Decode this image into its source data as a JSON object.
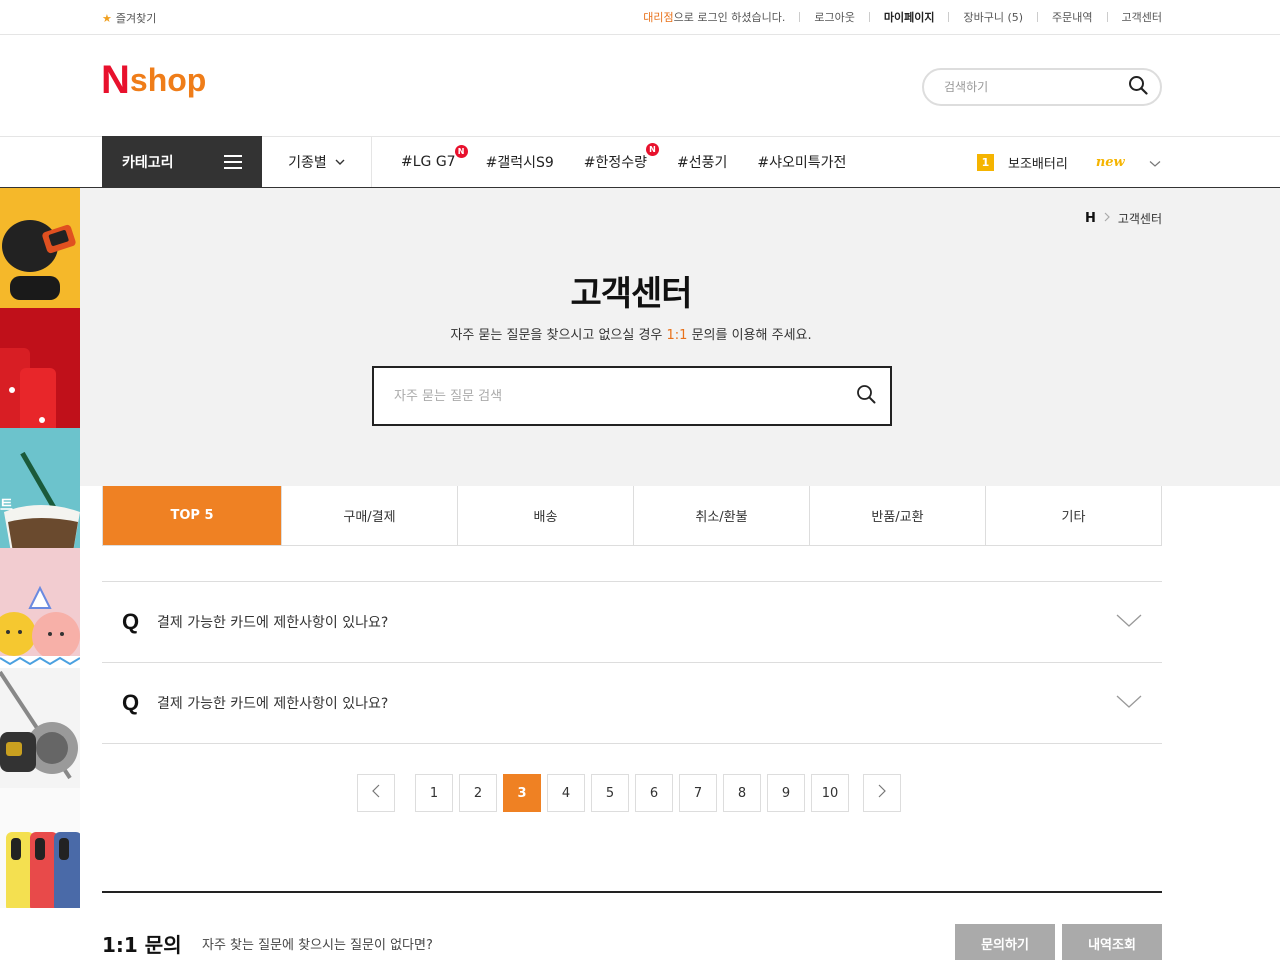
{
  "topbar": {
    "favorites": "즐겨찾기",
    "login_highlight": "대리점",
    "login_rest": "으로 로그인 하셨습니다.",
    "logout": "로그아웃",
    "mypage": "마이페이지",
    "cart": "장바구니 (5)",
    "orders": "주문내역",
    "support": "고객센터"
  },
  "header": {
    "logo_n": "N",
    "logo_shop": "shop",
    "search_placeholder": "검색하기"
  },
  "nav": {
    "category": "카테고리",
    "by_model": "기종별",
    "tags": [
      {
        "label": "#LG G7",
        "badge": "N"
      },
      {
        "label": "#갤럭시S9",
        "badge": ""
      },
      {
        "label": "#한정수량",
        "badge": "N"
      },
      {
        "label": "#선풍기",
        "badge": ""
      },
      {
        "label": "#샤오미특가전",
        "badge": ""
      }
    ],
    "rank_number": "1",
    "rank_label": "보조배터리",
    "rank_new": "new"
  },
  "breadcrumb": {
    "home": "H",
    "current": "고객센터"
  },
  "hero": {
    "title": "고객센터",
    "sub_before": "자주 묻는 질문을 찾으시고 없으실 경우 ",
    "sub_accent": "1:1",
    "sub_after": " 문의를 이용해 주세요.",
    "search_placeholder": "자주 묻는 질문 검색"
  },
  "tabs": [
    "TOP 5",
    "구매/결제",
    "배송",
    "취소/환불",
    "반품/교환",
    "기타"
  ],
  "faq": {
    "q_mark": "Q",
    "items": [
      "결제 가능한 카드에 제한사항이 있나요?",
      "결제 가능한 카드에 제한사항이 있나요?"
    ]
  },
  "pagination": {
    "pages": [
      "1",
      "2",
      "3",
      "4",
      "5",
      "6",
      "7",
      "8",
      "9",
      "10"
    ],
    "current": "3"
  },
  "inquiry": {
    "title": "1:1 문의",
    "desc": "자주 찾는 질문에 찾으시는 질문이 없다면?",
    "ask_button": "문의하기",
    "history_button": "내역조회"
  },
  "colors": {
    "accent": "#ef8123",
    "brand_red": "#e8112d",
    "brand_orange": "#ef7d19",
    "badge_yellow": "#f5b400"
  }
}
